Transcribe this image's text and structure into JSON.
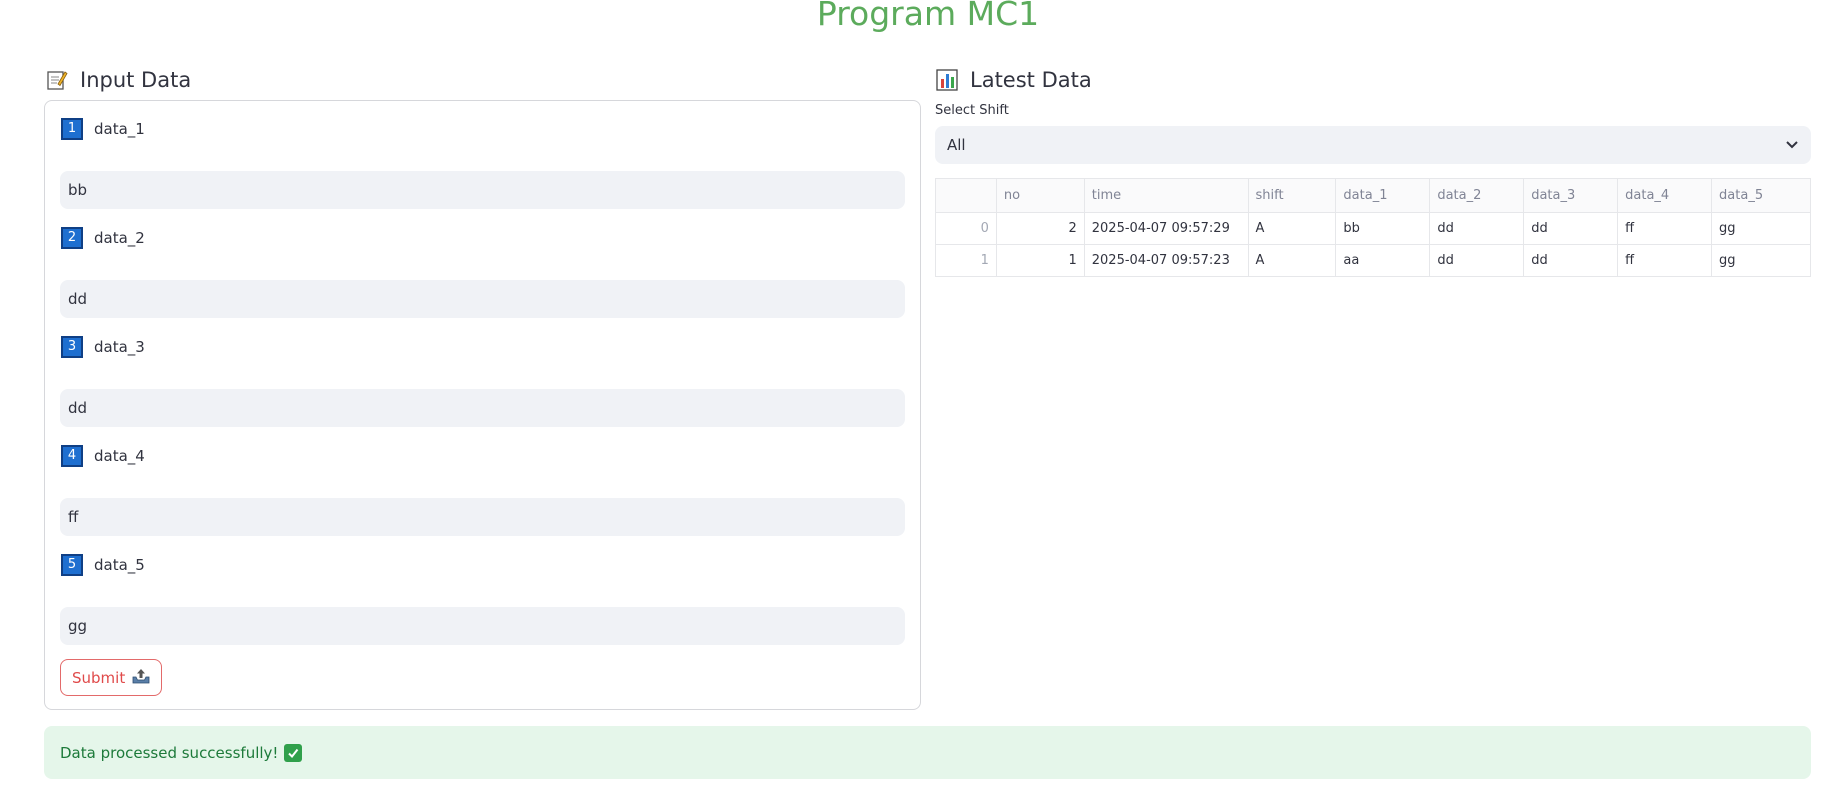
{
  "app": {
    "title": "Program MC1"
  },
  "input_section": {
    "title": "Input Data",
    "icon": "memo-icon",
    "fields": [
      {
        "number": "1",
        "label": "data_1",
        "value": "bb"
      },
      {
        "number": "2",
        "label": "data_2",
        "value": "dd"
      },
      {
        "number": "3",
        "label": "data_3",
        "value": "dd"
      },
      {
        "number": "4",
        "label": "data_4",
        "value": "ff"
      },
      {
        "number": "5",
        "label": "data_5",
        "value": "gg"
      }
    ],
    "submit_label": "Submit",
    "submit_icon": "outbox-tray-icon"
  },
  "latest_section": {
    "title": "Latest Data",
    "icon": "bar-chart-icon",
    "select_label": "Select Shift",
    "select_value": "All",
    "table": {
      "columns": [
        "",
        "no",
        "time",
        "shift",
        "data_1",
        "data_2",
        "data_3",
        "data_4",
        "data_5"
      ],
      "rows": [
        [
          "0",
          "2",
          "2025-04-07 09:57:29",
          "A",
          "bb",
          "dd",
          "dd",
          "ff",
          "gg"
        ],
        [
          "1",
          "1",
          "2025-04-07 09:57:23",
          "A",
          "aa",
          "dd",
          "dd",
          "ff",
          "gg"
        ]
      ]
    }
  },
  "alert": {
    "message": "Data processed successfully!",
    "icon": "check-mark-icon"
  },
  "colors": {
    "title_green": "#5cab5c",
    "badge_blue": "#1e6fd0",
    "submit_red": "#e04a4a",
    "success_bg": "#e5f6ea",
    "success_text": "#1d7a3a"
  }
}
